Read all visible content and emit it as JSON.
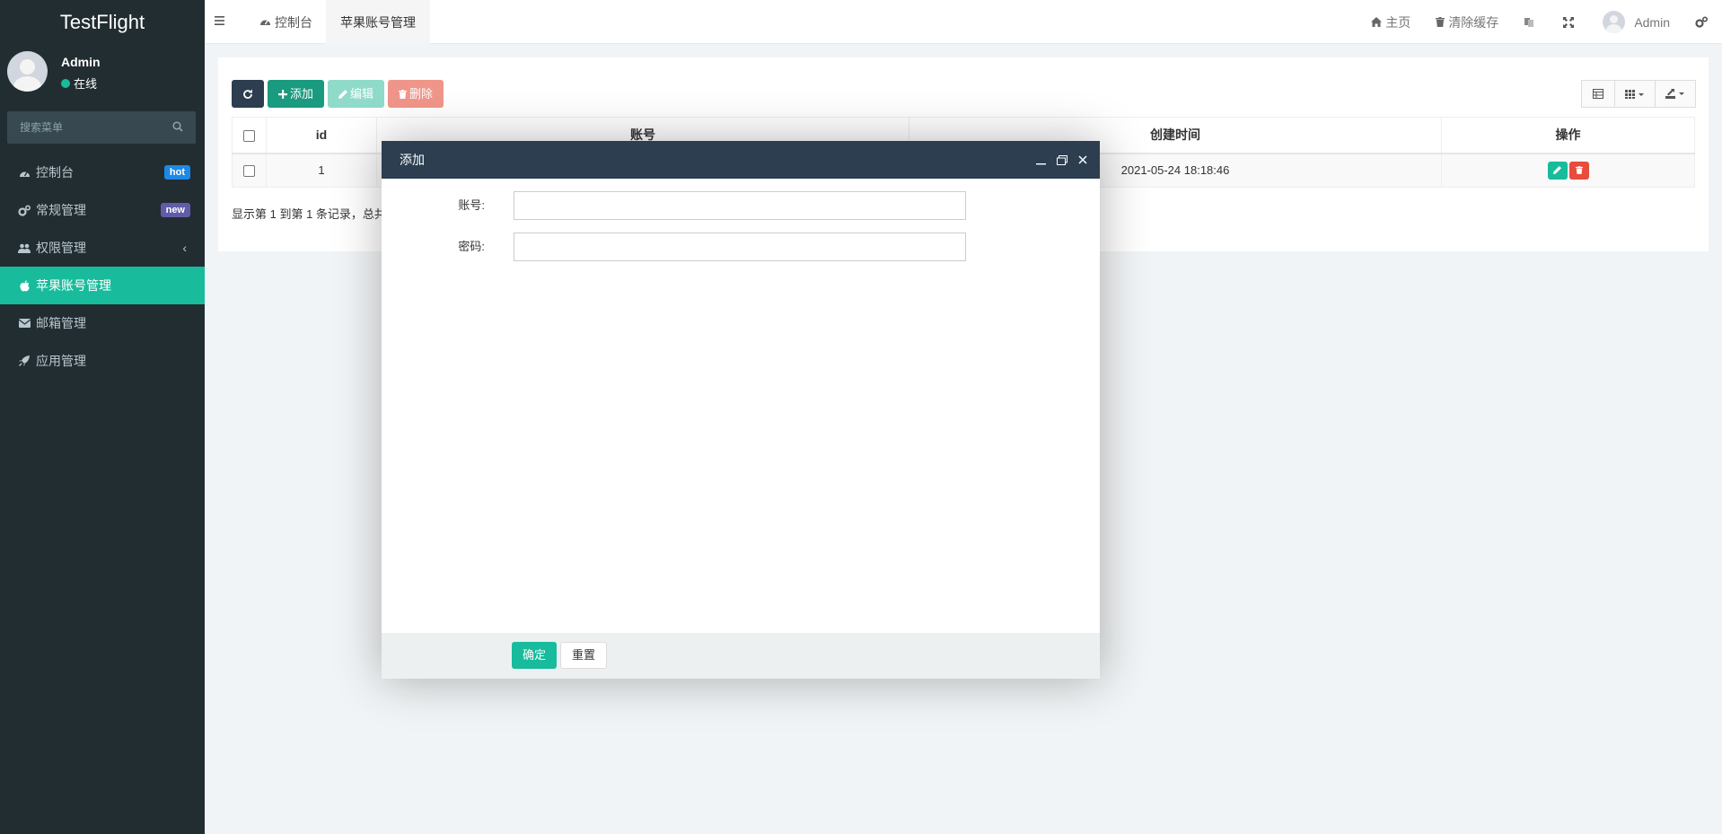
{
  "sidebar": {
    "logo": "TestFlight",
    "user": {
      "name": "Admin",
      "status": "在线"
    },
    "search_placeholder": "搜索菜单",
    "items": [
      {
        "label": "控制台",
        "icon": "dashboard-icon",
        "badge": "hot"
      },
      {
        "label": "常规管理",
        "icon": "cogs-icon",
        "badge": "new"
      },
      {
        "label": "权限管理",
        "icon": "users-icon",
        "chevron": "‹"
      },
      {
        "label": "苹果账号管理",
        "icon": "apple-icon",
        "active": true
      },
      {
        "label": "邮箱管理",
        "icon": "envelope-icon"
      },
      {
        "label": "应用管理",
        "icon": "rocket-icon"
      }
    ]
  },
  "topbar": {
    "tabs": [
      {
        "label": "控制台",
        "icon": "dashboard-icon"
      },
      {
        "label": "苹果账号管理",
        "active": true
      }
    ],
    "right": {
      "home": "主页",
      "clear_cache": "清除缓存",
      "user": "Admin"
    }
  },
  "toolbar": {
    "add": "添加",
    "edit": "编辑",
    "delete": "删除"
  },
  "table": {
    "columns": [
      "id",
      "账号",
      "创建时间",
      "操作"
    ],
    "rows": [
      {
        "id": "1",
        "account": "",
        "created": "2021-05-24 18:18:46"
      }
    ],
    "pager_text": "显示第 1 到第 1 条记录，总共"
  },
  "modal": {
    "title": "添加",
    "fields": [
      {
        "label": "账号:",
        "value": ""
      },
      {
        "label": "密码:",
        "value": ""
      }
    ],
    "ok": "确定",
    "reset": "重置"
  },
  "colors": {
    "sidebar_bg": "#222d32",
    "accent": "#18bc9c",
    "header_dark": "#2c3e50",
    "danger": "#e74c3c"
  }
}
